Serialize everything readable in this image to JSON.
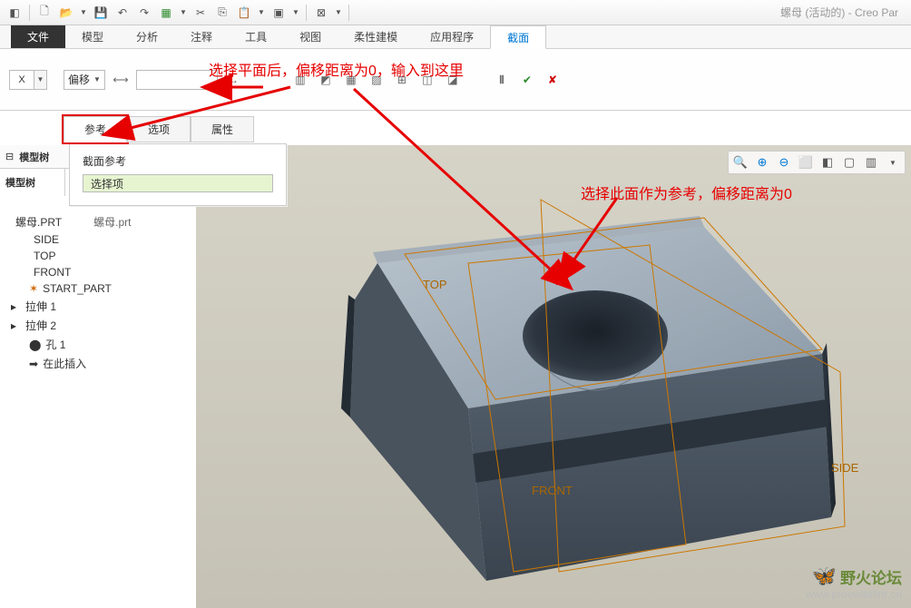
{
  "window_title": "螺母 (活动的) - Creo Par",
  "qat_icons": [
    "new",
    "open",
    "dd",
    "save",
    "undo",
    "redo",
    "regen",
    "dd",
    "cut",
    "copy",
    "paste",
    "dd",
    "close",
    "sep",
    "win-opts",
    "dd",
    "sep",
    "x",
    "dd"
  ],
  "ribbon_tabs": {
    "file": "文件",
    "items": [
      "模型",
      "分析",
      "注释",
      "工具",
      "视图",
      "柔性建模",
      "应用程序",
      "截面"
    ],
    "active": "截面"
  },
  "ribbon_row": {
    "type_label": "X",
    "offset_label": "偏移",
    "offset_value": "",
    "icons": [
      "dim",
      "flip",
      "i1",
      "i2",
      "i3",
      "i4",
      "i5",
      "i6",
      "i7",
      "pause",
      "ok",
      "cancel"
    ]
  },
  "annotation1": "选择平面后，偏移距离为0，输入到这里",
  "annotation2": "选择此面作为参考，偏移距离为0",
  "sub_tabs": {
    "items": [
      "参考",
      "选项",
      "属性"
    ],
    "active": "参考"
  },
  "ref_panel": {
    "label": "截面参考",
    "value": "选择项"
  },
  "tree_top": {
    "a": "模型树",
    "b": "模型树"
  },
  "viewport_labels": {
    "top": "TOP",
    "front": "FRONT",
    "side": "SIDE"
  },
  "model_tree": [
    {
      "icon": "part",
      "label": "螺母.PRT",
      "lev": 0
    },
    {
      "icon": "plane",
      "label": "SIDE",
      "lev": 1
    },
    {
      "icon": "plane",
      "label": "TOP",
      "lev": 1
    },
    {
      "icon": "plane",
      "label": "FRONT",
      "lev": 1
    },
    {
      "icon": "csys",
      "label": "START_PART",
      "lev": 1
    },
    {
      "icon": "ext",
      "label": "拉伸 1",
      "lev": 0,
      "exp": "▸"
    },
    {
      "icon": "ext",
      "label": "拉伸 2",
      "lev": 0,
      "exp": "▸"
    },
    {
      "icon": "hole",
      "label": "孔 1",
      "lev": 1
    },
    {
      "icon": "ins",
      "label": "在此插入",
      "lev": 1
    }
  ],
  "tree_filename": "螺母.prt",
  "view_tools": [
    "🔍",
    "⊕",
    "⊖",
    "⬜",
    "🔲",
    "◧",
    "▢",
    "▾"
  ],
  "watermark": {
    "line1": "野火论坛",
    "line2": "www.proewildfire.cn"
  }
}
